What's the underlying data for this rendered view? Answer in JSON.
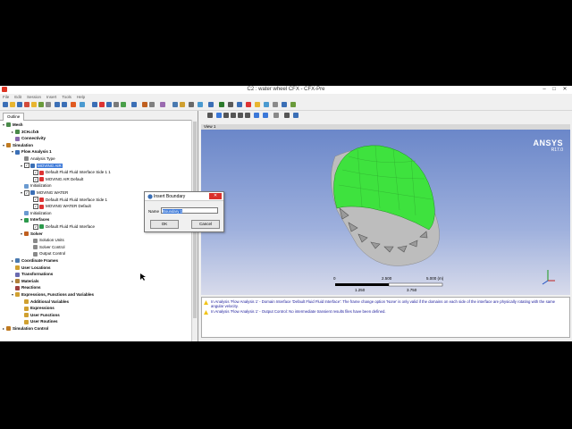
{
  "window": {
    "title": "C2 : water wheel CFX - CFX-Pre",
    "min": "–",
    "max": "□",
    "close": "✕"
  },
  "menu": [
    "File",
    "Edit",
    "Session",
    "Insert",
    "Tools",
    "Help"
  ],
  "outline_tab": "Outline",
  "tree": [
    {
      "label": "Mesh",
      "level": 0,
      "bold": true,
      "exp": "▾",
      "icon": "mesh"
    },
    {
      "label": "3CH.cfx5",
      "level": 1,
      "bold": true,
      "exp": "▸",
      "icon": "mesh"
    },
    {
      "label": "Connectivity",
      "level": 1,
      "bold": true,
      "exp": "",
      "icon": "conn"
    },
    {
      "label": "Simulation",
      "level": 0,
      "bold": true,
      "exp": "▾",
      "icon": "sim"
    },
    {
      "label": "Flow Analysis 1",
      "level": 1,
      "bold": true,
      "exp": "▾",
      "icon": "flow"
    },
    {
      "label": "Analysis Type",
      "level": 2,
      "bold": false,
      "exp": "",
      "icon": "clock"
    },
    {
      "label": "MOVING AIR",
      "level": 2,
      "bold": false,
      "exp": "▾",
      "icon": "domain",
      "check": true,
      "selected": true
    },
    {
      "label": "Default Fluid Fluid Interface Side 1 1",
      "level": 3,
      "bold": false,
      "exp": "",
      "icon": "bnd",
      "check": true
    },
    {
      "label": "MOVING AIR Default",
      "level": 3,
      "bold": false,
      "exp": "",
      "icon": "bnd",
      "check": true
    },
    {
      "label": "Initialization",
      "level": 2,
      "bold": false,
      "exp": "",
      "icon": "init"
    },
    {
      "label": "MOVING WATER",
      "level": 2,
      "bold": false,
      "exp": "▾",
      "icon": "domain",
      "check": true
    },
    {
      "label": "Default Fluid Fluid Interface Side 1",
      "level": 3,
      "bold": false,
      "exp": "",
      "icon": "bnd",
      "check": true
    },
    {
      "label": "MOVING WATER Default",
      "level": 3,
      "bold": false,
      "exp": "",
      "icon": "bnd",
      "check": true
    },
    {
      "label": "Initialization",
      "level": 2,
      "bold": false,
      "exp": "",
      "icon": "init"
    },
    {
      "label": "Interfaces",
      "level": 2,
      "bold": true,
      "exp": "▾",
      "icon": "iface"
    },
    {
      "label": "Default Fluid Fluid Interface",
      "level": 3,
      "bold": false,
      "exp": "",
      "icon": "iface",
      "check": true
    },
    {
      "label": "Solver",
      "level": 2,
      "bold": true,
      "exp": "▾",
      "icon": "solver"
    },
    {
      "label": "Solution Units",
      "level": 3,
      "bold": false,
      "exp": "",
      "icon": "doc"
    },
    {
      "label": "Solver Control",
      "level": 3,
      "bold": false,
      "exp": "",
      "icon": "doc"
    },
    {
      "label": "Output Control",
      "level": 3,
      "bold": false,
      "exp": "",
      "icon": "doc"
    },
    {
      "label": "Coordinate Frames",
      "level": 1,
      "bold": true,
      "exp": "▸",
      "icon": "frame"
    },
    {
      "label": "User Locations",
      "level": 1,
      "bold": true,
      "exp": "",
      "icon": "loc"
    },
    {
      "label": "Transformations",
      "level": 1,
      "bold": true,
      "exp": "",
      "icon": "trans"
    },
    {
      "label": "Materials",
      "level": 1,
      "bold": true,
      "exp": "▸",
      "icon": "mat"
    },
    {
      "label": "Reactions",
      "level": 1,
      "bold": true,
      "exp": "",
      "icon": "react"
    },
    {
      "label": "Expressions, Functions and Variables",
      "level": 1,
      "bold": true,
      "exp": "▾",
      "icon": "expr"
    },
    {
      "label": "Additional Variables",
      "level": 2,
      "bold": true,
      "exp": "",
      "icon": "expr"
    },
    {
      "label": "Expressions",
      "level": 2,
      "bold": true,
      "exp": "",
      "icon": "expr"
    },
    {
      "label": "User Functions",
      "level": 2,
      "bold": true,
      "exp": "",
      "icon": "expr"
    },
    {
      "label": "User Routines",
      "level": 2,
      "bold": true,
      "exp": "",
      "icon": "expr"
    },
    {
      "label": "Simulation Control",
      "level": 0,
      "bold": true,
      "exp": "▸",
      "icon": "sim"
    }
  ],
  "view": {
    "header": "View 1",
    "brand": "ANSYS",
    "version": "R17.0"
  },
  "scale": {
    "top_labels": [
      "0",
      "2.500",
      "5.000  (m)"
    ],
    "bottom_labels": [
      "1.250",
      "3.750"
    ]
  },
  "messages": [
    "In Analysis 'Flow Analysis 1' - Domain Interface 'Default Fluid Fluid Interface': The frame change option 'None' is only valid if the domains on each side of the interface are physically rotating with the same angular velocity.",
    "In Analysis 'Flow Analysis 1' - Output Control: No intermediate transient results files have been defined."
  ],
  "dialog": {
    "title": "Insert Boundary",
    "close": "✕",
    "name_label": "Name",
    "name_value": "Boundary 1",
    "ok": "OK",
    "cancel": "Cancel"
  },
  "colors": {
    "wheel_face": "#3ee23e",
    "wheel_body": "#b8b8b8",
    "view_bg_top": "#6b87c9",
    "view_bg_bottom": "#d8dbeb",
    "selection": "#3b78d8"
  }
}
